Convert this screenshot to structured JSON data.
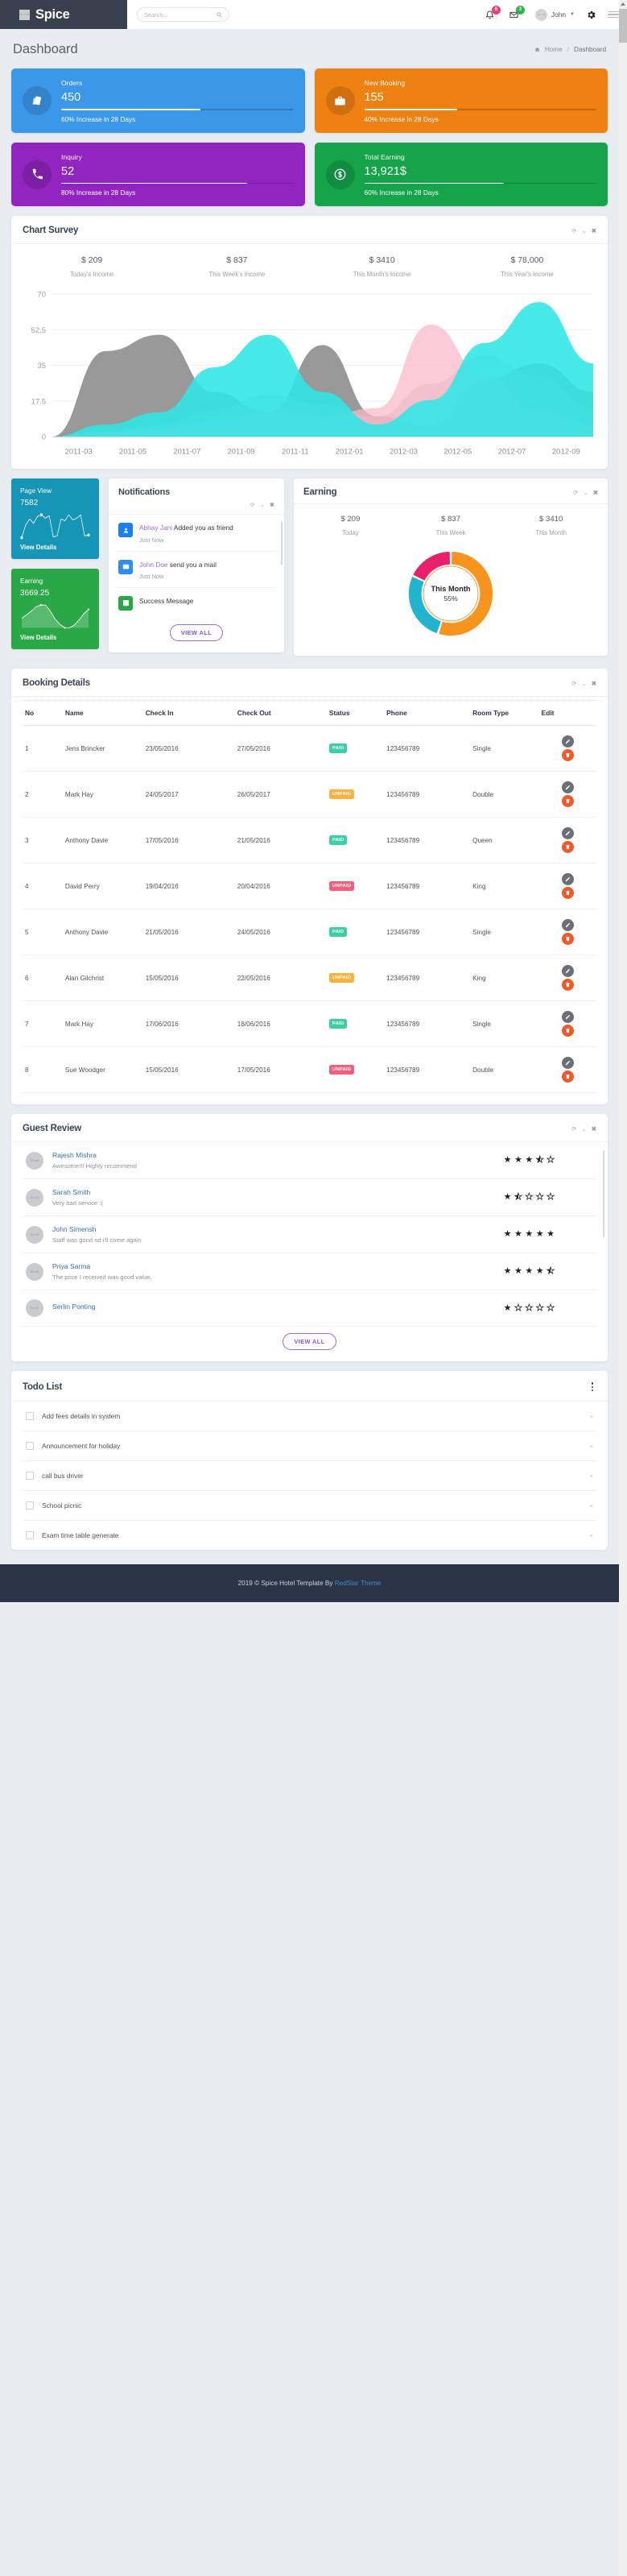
{
  "header": {
    "logo_alt": "40 x 40",
    "brand": "Spice",
    "search_placeholder": "Search...",
    "search_value": "",
    "notifications_count": "6",
    "messages_count": "2",
    "user_name": "John",
    "user_avatar_alt": "40 x 40"
  },
  "page": {
    "title": "Dashboard",
    "breadcrumb_home": "Home",
    "breadcrumb_sep": "/",
    "breadcrumb_current": "Dashboard"
  },
  "stats": [
    {
      "label": "Orders",
      "value": "450",
      "sub": "60% Increase in 28 Days",
      "progress": 60,
      "color": "#3b97e8",
      "icon": "cards-icon"
    },
    {
      "label": "New Booking",
      "value": "155",
      "sub": "40% Increase in 28 Days",
      "progress": 40,
      "color": "#ef8012",
      "icon": "briefcase-icon"
    },
    {
      "label": "Inquiry",
      "value": "52",
      "sub": "80% Increase in 28 Days",
      "progress": 80,
      "color": "#9224c0",
      "icon": "phone-icon"
    },
    {
      "label": "Total Earning",
      "value": "13,921$",
      "sub": "60% Increase in 28 Days",
      "progress": 60,
      "color": "#16a44b",
      "icon": "dollar-icon"
    }
  ],
  "chart_survey": {
    "title": "Chart Survey",
    "tools": {
      "refresh": "⟳",
      "collapse": "⌄",
      "close": "✖"
    },
    "summary": [
      {
        "amount": "$ 209",
        "label": "Today's Income"
      },
      {
        "amount": "$ 837",
        "label": "This Week's Income"
      },
      {
        "amount": "$ 3410",
        "label": "This Month's Income"
      },
      {
        "amount": "$ 78,000",
        "label": "This Year's Income"
      }
    ]
  },
  "chart_data": {
    "type": "area",
    "title": "Chart Survey",
    "xlabel": "",
    "ylabel": "",
    "ylim": [
      0,
      70
    ],
    "yticks": [
      0,
      17.5,
      35,
      52.5,
      70
    ],
    "grid": true,
    "legend": "none",
    "categories": [
      "2011-03",
      "2011-05",
      "2011-07",
      "2011-09",
      "2011-11",
      "2012-01",
      "2012-03",
      "2012-05",
      "2012-07",
      "2012-09"
    ],
    "series": [
      {
        "name": "Grey",
        "color": "#7c7c7c",
        "values": [
          0,
          42,
          50,
          22,
          12,
          45,
          10,
          5,
          28,
          36,
          22
        ]
      },
      {
        "name": "Cyan",
        "color": "#2fe6e6",
        "values": [
          0,
          6,
          12,
          34,
          50,
          22,
          6,
          18,
          46,
          66,
          36
        ]
      },
      {
        "name": "Pink",
        "color": "#f9b8c8",
        "values": [
          0,
          2,
          4,
          7,
          12,
          10,
          14,
          55,
          30,
          12,
          6
        ]
      },
      {
        "name": "Mauve",
        "color": "#cbc0c6",
        "values": [
          0,
          3,
          6,
          13,
          21,
          16,
          10,
          26,
          40,
          30,
          14
        ]
      }
    ]
  },
  "page_view": {
    "title": "Page View",
    "value": "7582",
    "link": "View Details",
    "color": "#1695b7",
    "spark": [
      18,
      48,
      62,
      52,
      68,
      72,
      64,
      70,
      20,
      22,
      62,
      58,
      72,
      60,
      64,
      72,
      22,
      24
    ]
  },
  "earning_card": {
    "title": "Earning",
    "value": "3669.25",
    "link": "View Details",
    "color": "#2aa747",
    "spark": [
      42,
      50,
      58,
      68,
      72,
      72,
      58,
      40,
      28,
      20,
      20,
      26,
      38,
      52,
      62
    ]
  },
  "notifications": {
    "title": "Notifications",
    "tools": {
      "refresh": "⟳",
      "collapse": "⌄",
      "close": "✖"
    },
    "items": [
      {
        "icon": "user-icon",
        "actor": "Abhay Jani",
        "text": " Added you as friend",
        "time": "Just Now",
        "color": "#1b7ff2"
      },
      {
        "icon": "mail-icon",
        "actor": "John Doe",
        "text": " send you a mail",
        "time": "Just Now",
        "color": "#2e8df0"
      },
      {
        "icon": "check-square-icon",
        "actor": "",
        "text": "Success Message",
        "time": "",
        "color": "#2aa747"
      }
    ],
    "view_all": "VIEW ALL"
  },
  "earning_panel": {
    "title": "Earning",
    "tools": {
      "refresh": "⟳",
      "collapse": "⌄",
      "close": "✖"
    },
    "columns": [
      {
        "amount": "$ 209",
        "label": "Today"
      },
      {
        "amount": "$ 837",
        "label": "This Week"
      },
      {
        "amount": "$ 3410",
        "label": "This Month"
      }
    ],
    "donut": {
      "center_title": "This Month",
      "center_pct": "55%",
      "slices": [
        {
          "name": "orange",
          "value": 55,
          "color": "#f7941e"
        },
        {
          "name": "cyan",
          "value": 27,
          "color": "#21b4cc"
        },
        {
          "name": "pink",
          "value": 18,
          "color": "#e8206c"
        }
      ]
    }
  },
  "booking": {
    "title": "Booking Details",
    "tools": {
      "refresh": "⟳",
      "collapse": "⌄",
      "close": "✖"
    },
    "columns": [
      "No",
      "Name",
      "Check In",
      "Check Out",
      "Status",
      "Phone",
      "Room Type",
      "Edit"
    ],
    "rows": [
      {
        "no": "1",
        "name": "Jens Brincker",
        "checkin": "23/05/2016",
        "checkout": "27/05/2016",
        "status": "PAID",
        "status_type": "paid",
        "phone": "123456789",
        "room": "Single"
      },
      {
        "no": "2",
        "name": "Mark Hay",
        "checkin": "24/05/2017",
        "checkout": "26/05/2017",
        "status": "UNPAID",
        "status_type": "unpaid-orange",
        "phone": "123456789",
        "room": "Double"
      },
      {
        "no": "3",
        "name": "Anthony Davie",
        "checkin": "17/05/2016",
        "checkout": "21/05/2016",
        "status": "PAID",
        "status_type": "paid",
        "phone": "123456789",
        "room": "Queen"
      },
      {
        "no": "4",
        "name": "David Perry",
        "checkin": "19/04/2016",
        "checkout": "20/04/2016",
        "status": "UNPAID",
        "status_type": "unpaid-red",
        "phone": "123456789",
        "room": "King"
      },
      {
        "no": "5",
        "name": "Anthony Davie",
        "checkin": "21/05/2016",
        "checkout": "24/05/2016",
        "status": "PAID",
        "status_type": "paid",
        "phone": "123456789",
        "room": "Single"
      },
      {
        "no": "6",
        "name": "Alan Gilchrist",
        "checkin": "15/05/2016",
        "checkout": "22/05/2016",
        "status": "UNPAID",
        "status_type": "unpaid-orange",
        "phone": "123456789",
        "room": "King"
      },
      {
        "no": "7",
        "name": "Mark Hay",
        "checkin": "17/06/2016",
        "checkout": "18/06/2016",
        "status": "PAID",
        "status_type": "paid",
        "phone": "123456789",
        "room": "Single"
      },
      {
        "no": "8",
        "name": "Sue Woodger",
        "checkin": "15/05/2016",
        "checkout": "17/05/2016",
        "status": "UNPAID",
        "status_type": "unpaid-red",
        "phone": "123456789",
        "room": "Double"
      }
    ]
  },
  "guest_review": {
    "title": "Guest Review",
    "tools": {
      "refresh": "⟳",
      "collapse": "⌄",
      "close": "✖"
    },
    "avatar_alt": "40 x 40",
    "items": [
      {
        "name": "Rajesh Mishra",
        "text": "Awesome!!! Highly recommend",
        "rating": 3.5
      },
      {
        "name": "Sarah Smith",
        "text": "Very bad service :(",
        "rating": 1.5
      },
      {
        "name": "John Simensh",
        "text": "Staff was good nd i'll come again",
        "rating": 5
      },
      {
        "name": "Priya Sarma",
        "text": "The price I received was good value.",
        "rating": 4.5
      },
      {
        "name": "Serlin Ponting",
        "text": "",
        "rating": 1
      }
    ],
    "view_all": "VIEW ALL"
  },
  "todo": {
    "title": "Todo List",
    "items": [
      {
        "label": "Add fees details in system",
        "done": false
      },
      {
        "label": "Announcement for holiday",
        "done": false
      },
      {
        "label": "call bus driver",
        "done": false
      },
      {
        "label": "School picnic",
        "done": false
      },
      {
        "label": "Exam time table generate",
        "done": false
      }
    ],
    "remove_glyph": "×"
  },
  "footer": {
    "text_before": "2019 © Spice Hotel Template By ",
    "link": "RedStar Theme"
  }
}
